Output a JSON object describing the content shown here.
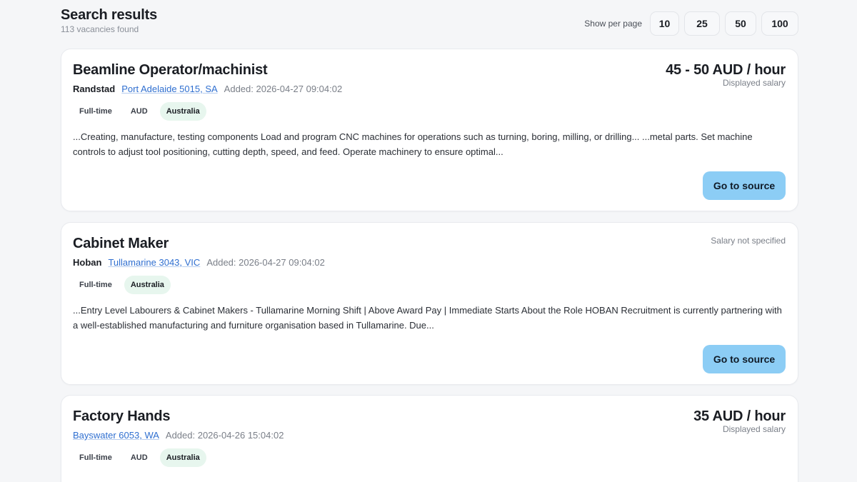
{
  "header": {
    "title": "Search results",
    "count_text": "113 vacancies found",
    "per_page_label": "Show per page",
    "per_page_options": [
      "10",
      "25",
      "50",
      "100"
    ]
  },
  "jobs": [
    {
      "title": "Beamline Operator/machinist",
      "company": "Randstad",
      "location": "Port Adelaide 5015, SA",
      "added": "Added: 2026-04-27 09:04:02",
      "salary": "45 - 50 AUD / hour",
      "salary_note": "Displayed salary",
      "tags": [
        "Full-time",
        "AUD",
        "Australia"
      ],
      "description": "...Creating, manufacture, testing components Load and program CNC machines for operations such as turning, boring, milling, or drilling... ...metal parts. Set machine controls to adjust tool positioning, cutting depth, speed, and feed. Operate machinery to ensure optimal...",
      "button": "Go to source"
    },
    {
      "title": "Cabinet Maker",
      "company": "Hoban",
      "location": "Tullamarine 3043, VIC",
      "added": "Added: 2026-04-27 09:04:02",
      "salary_none": "Salary not specified",
      "tags": [
        "Full-time",
        "Australia"
      ],
      "description": "...Entry Level Labourers & Cabinet Makers - Tullamarine Morning Shift | Above Award Pay | Immediate Starts About the Role HOBAN Recruitment is currently partnering with a well-established manufacturing and furniture organisation based in Tullamarine. Due...",
      "button": "Go to source"
    },
    {
      "title": "Factory Hands",
      "location": "Bayswater 6053, WA",
      "added": "Added: 2026-04-26 15:04:02",
      "salary": "35 AUD / hour",
      "salary_note": "Displayed salary",
      "tags": [
        "Full-time",
        "AUD",
        "Australia"
      ]
    }
  ]
}
